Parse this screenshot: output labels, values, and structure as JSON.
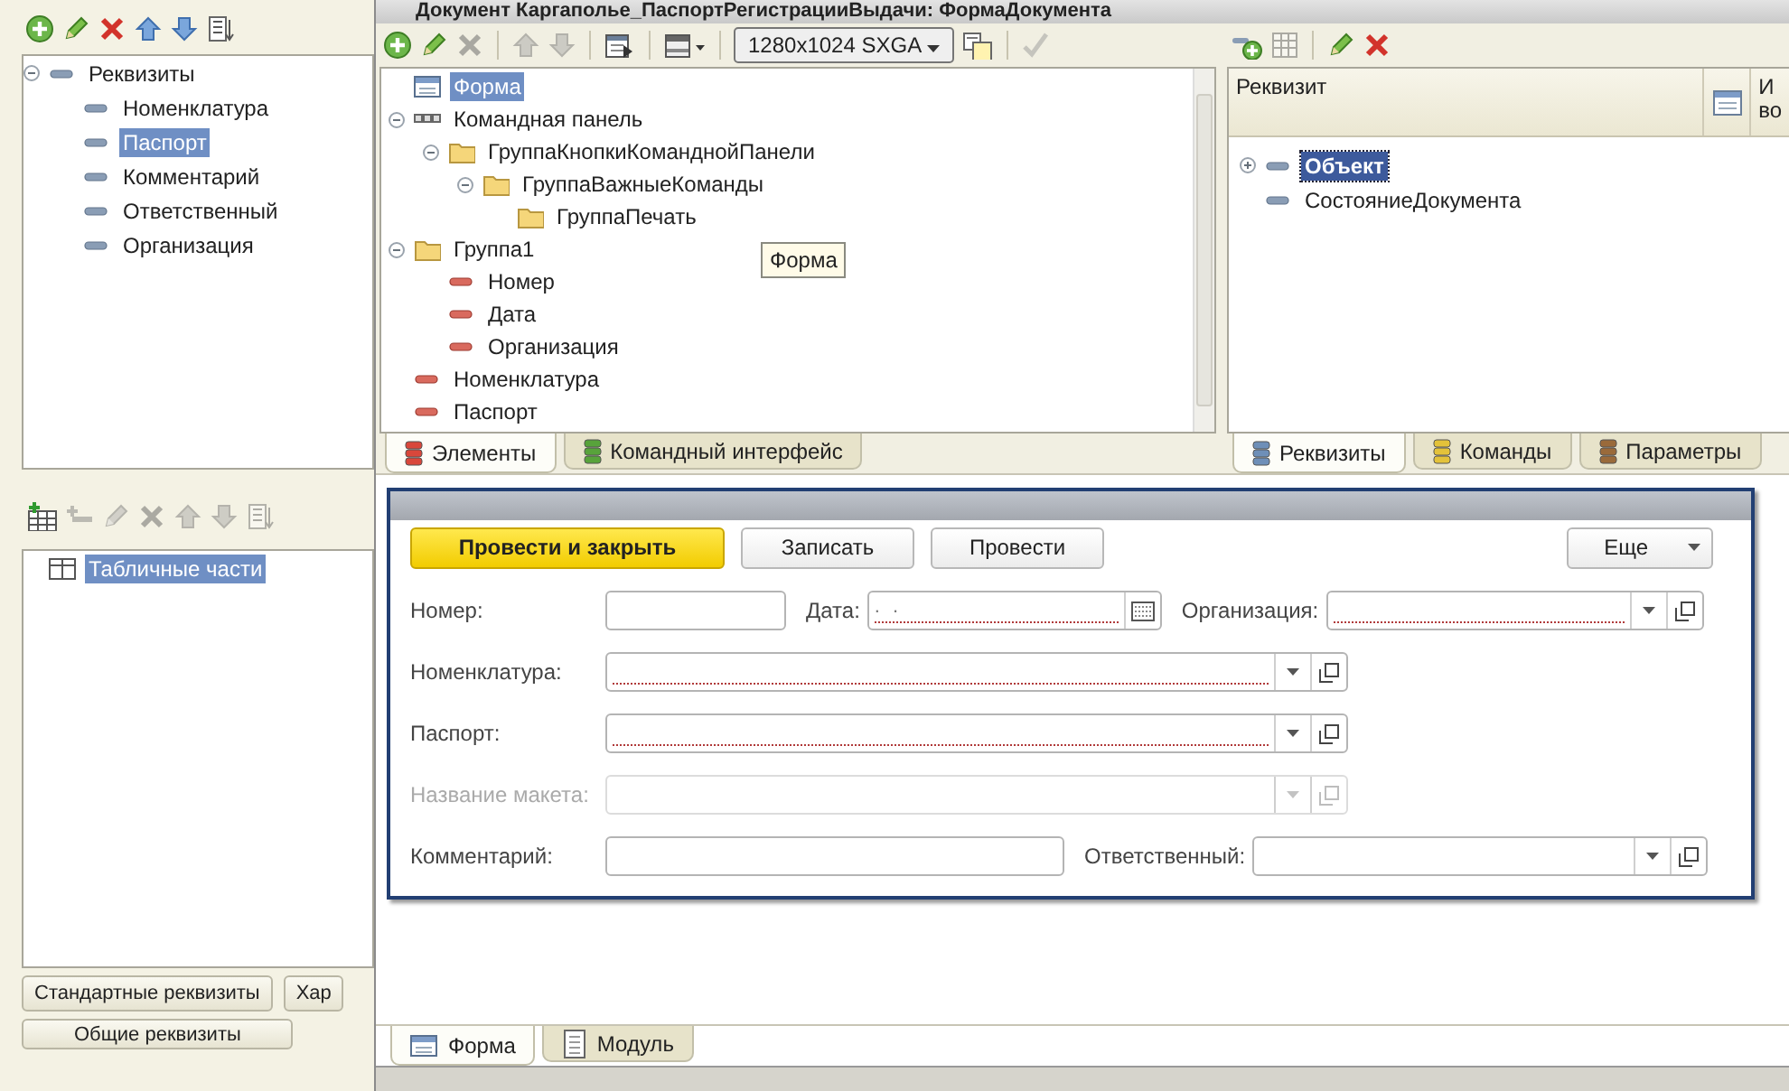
{
  "window": {
    "title": "Документ Каргаполье_ПаспортРегистрацииВыдачи: ФормаДокумента"
  },
  "attributes_panel": {
    "toolbar": [
      {
        "kind": "add",
        "disabled": false
      },
      {
        "kind": "edit",
        "disabled": false
      },
      {
        "kind": "delete",
        "disabled": false
      },
      {
        "kind": "up",
        "disabled": false
      },
      {
        "kind": "down",
        "disabled": false
      },
      {
        "kind": "sort",
        "disabled": false
      }
    ],
    "tree": [
      {
        "label": "Реквизиты",
        "kind": "attribute",
        "selected": false,
        "expanded": true,
        "children": [
          {
            "label": "Номенклатура",
            "kind": "attribute",
            "selected": false
          },
          {
            "label": "Паспорт",
            "kind": "attribute",
            "selected": true
          },
          {
            "label": "Комментарий",
            "kind": "attribute",
            "selected": false
          },
          {
            "label": "Ответственный",
            "kind": "attribute",
            "selected": false
          },
          {
            "label": "Организация",
            "kind": "attribute",
            "selected": false
          }
        ]
      }
    ],
    "tables_toolbar": [
      {
        "kind": "add_table",
        "disabled": false
      },
      {
        "kind": "add_row",
        "disabled": true
      },
      {
        "kind": "edit",
        "disabled": true
      },
      {
        "kind": "delete",
        "disabled": true
      },
      {
        "kind": "up",
        "disabled": true
      },
      {
        "kind": "down",
        "disabled": true
      },
      {
        "kind": "sort",
        "disabled": true
      }
    ],
    "tables_tree": [
      {
        "label": "Табличные части",
        "kind": "table",
        "selected": true
      }
    ],
    "button_rows": [
      [
        "Стандартные реквизиты",
        "Хар"
      ],
      [
        "Общие реквизиты"
      ]
    ]
  },
  "elements_panel": {
    "toolbar": [
      {
        "kind": "add",
        "disabled": false
      },
      {
        "kind": "edit",
        "disabled": false
      },
      {
        "kind": "delete",
        "disabled": true
      },
      {
        "kind": "separator"
      },
      {
        "kind": "up",
        "disabled": true
      },
      {
        "kind": "down",
        "disabled": true
      },
      {
        "kind": "separator"
      },
      {
        "kind": "layout",
        "disabled": false
      },
      {
        "kind": "separator"
      },
      {
        "kind": "panel_menu",
        "disabled": false
      },
      {
        "kind": "separator"
      },
      {
        "kind": "resolution",
        "label": "1280x1024 SXGA"
      },
      {
        "kind": "copy_layout",
        "disabled": false
      },
      {
        "kind": "separator"
      },
      {
        "kind": "check",
        "disabled": true
      }
    ],
    "tree": [
      {
        "label": "Форма",
        "kind": "form",
        "selected": true
      },
      {
        "label": "Командная панель",
        "kind": "command_panel",
        "selected": false,
        "expanded": true,
        "children": [
          {
            "label": "ГруппаКнопкиКоманднойПанели",
            "kind": "group",
            "selected": false,
            "expanded": true,
            "children": [
              {
                "label": "ГруппаВажныеКоманды",
                "kind": "group",
                "selected": false,
                "expanded": true,
                "children": [
                  {
                    "label": "ГруппаПечать",
                    "kind": "group",
                    "selected": false
                  }
                ]
              }
            ]
          }
        ]
      },
      {
        "label": "Группа1",
        "kind": "group",
        "selected": false,
        "expanded": true,
        "children": [
          {
            "label": "Номер",
            "kind": "field",
            "selected": false
          },
          {
            "label": "Дата",
            "kind": "field",
            "selected": false
          },
          {
            "label": "Организация",
            "kind": "field",
            "selected": false
          }
        ]
      },
      {
        "label": "Номенклатура",
        "kind": "field",
        "selected": false
      },
      {
        "label": "Паспорт",
        "kind": "field",
        "selected": false
      }
    ],
    "tooltip": "Форма",
    "tabs": [
      {
        "label": "Элементы",
        "kind": "elements",
        "selected": true
      },
      {
        "label": "Командный интерфейс",
        "kind": "commands",
        "selected": false
      }
    ]
  },
  "form_attributes_panel": {
    "toolbar": [
      {
        "kind": "add_attr",
        "disabled": false
      },
      {
        "kind": "table",
        "disabled": true
      },
      {
        "kind": "separator"
      },
      {
        "kind": "edit",
        "disabled": false
      },
      {
        "kind": "delete",
        "disabled": false
      }
    ],
    "column_1": "Реквизит",
    "column_3": [
      "И",
      "во"
    ],
    "tree": [
      {
        "label": "Объект",
        "kind": "object",
        "selected": true,
        "expanded": false
      },
      {
        "label": "СостояниеДокумента",
        "kind": "attribute",
        "selected": false
      }
    ],
    "tabs": [
      {
        "label": "Реквизиты",
        "kind": "attributes",
        "selected": true
      },
      {
        "label": "Команды",
        "kind": "commands_y",
        "selected": false
      },
      {
        "label": "Параметры",
        "kind": "params",
        "selected": false
      }
    ]
  },
  "form_preview": {
    "buttons": [
      {
        "label": "Провести и закрыть",
        "kind": "default"
      },
      {
        "label": "Записать",
        "kind": "normal"
      },
      {
        "label": "Провести",
        "kind": "normal"
      }
    ],
    "more_button": "Еще",
    "rows": [
      [
        {
          "label": "Номер:",
          "kind": "text",
          "required": false,
          "disabled": false
        },
        {
          "label": "Дата:",
          "kind": "date",
          "value": ". .",
          "required": true,
          "disabled": false
        },
        {
          "label": "Организация:",
          "kind": "select",
          "required": true,
          "disabled": false
        }
      ],
      [
        {
          "label": "Номенклатура:",
          "kind": "select",
          "required": true,
          "disabled": false
        }
      ],
      [
        {
          "label": "Паспорт:",
          "kind": "select",
          "required": true,
          "disabled": false
        }
      ],
      [
        {
          "label": "Название макета:",
          "kind": "select",
          "required": false,
          "disabled": true
        }
      ],
      [
        {
          "label": "Комментарий:",
          "kind": "text",
          "required": false,
          "disabled": false
        },
        {
          "label": "Ответственный:",
          "kind": "select",
          "required": false,
          "disabled": false
        }
      ]
    ]
  },
  "bottom_tabs": [
    {
      "label": "Форма",
      "kind": "form",
      "selected": true
    },
    {
      "label": "Модуль",
      "kind": "module",
      "selected": false
    }
  ]
}
